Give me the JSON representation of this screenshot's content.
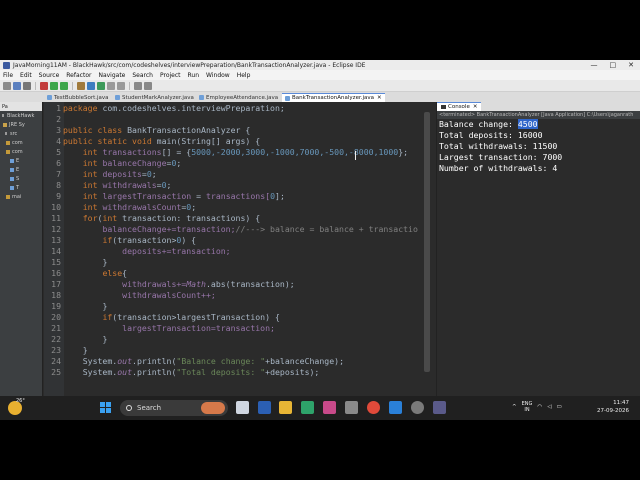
{
  "window": {
    "title": "JavaMorning11AM - BlackHawk/src/com/codeshelves/interviewPreparation/BankTransactionAnalyzer.java - Eclipse IDE",
    "controls": [
      "—",
      "□",
      "✕"
    ]
  },
  "menu": [
    "File",
    "Edit",
    "Source",
    "Refactor",
    "Navigate",
    "Search",
    "Project",
    "Run",
    "Window",
    "Help"
  ],
  "editor_tabs": [
    {
      "label": "TestBubbleSort.java"
    },
    {
      "label": "StudentMarkAnalyzer.java"
    },
    {
      "label": "EmployeeAttendance.java"
    },
    {
      "label": "BankTransactionAnalyzer.java",
      "close": "✕"
    }
  ],
  "sidebar": {
    "header": "Pa",
    "items": [
      "BlackHawk",
      "JRE Sy",
      "src",
      "com",
      "com",
      "E",
      "E",
      "S",
      "T",
      "mai"
    ]
  },
  "code": {
    "line_numbers": [
      "1",
      "2",
      "3",
      "4",
      "5",
      "6",
      "7",
      "8",
      "9",
      "10",
      "11",
      "12",
      "13",
      "14",
      "15",
      "16",
      "17",
      "18",
      "19",
      "20",
      "21",
      "22",
      "23",
      "24",
      "25"
    ],
    "l1": {
      "kw": "package",
      "rest": " com.codeshelves.interviewPreparation;"
    },
    "l3": {
      "kw1": "public",
      "kw2": "class",
      "name": " BankTransactionAnalyzer {"
    },
    "l4": {
      "kw1": "public",
      "kw2": "static",
      "kw3": "void",
      "rest": " main(String[] args) {"
    },
    "l5": {
      "kw": "int",
      "var": " transactions",
      "op": "[] = {",
      "nums": "5000,-2000,3000,-1000,7000,-500,-8000,1000",
      "end": "};"
    },
    "l6": {
      "kw": "int",
      "var": " balanceChange",
      "op": "=",
      "num": "0",
      "end": ";"
    },
    "l7": {
      "kw": "int",
      "var": " deposits",
      "op": "=",
      "num": "0",
      "end": ";"
    },
    "l8": {
      "kw": "int",
      "var": " withdrawals",
      "op": "=",
      "num": "0",
      "end": ";"
    },
    "l9": {
      "kw": "int",
      "var": " largestTransaction",
      "op": " = ",
      "rest": "transactions[",
      "num": "0",
      "end": "];"
    },
    "l10": {
      "kw": "int",
      "var": " withdrawalsCount",
      "op": "=",
      "num": "0",
      "end": ";"
    },
    "l11": {
      "kw": "for",
      "rest": "(",
      "kw2": "int",
      "rest2": " transaction: transactions) {"
    },
    "l12": {
      "code": "balanceChange+=transaction;",
      "comment": "//---> balance = balance + transactio"
    },
    "l13": {
      "kw": "if",
      "rest": "(transaction>",
      "num": "0",
      "end": ") {"
    },
    "l14": {
      "code": "deposits+=transaction;"
    },
    "l15": {
      "code": "}"
    },
    "l16": {
      "kw": "else",
      "code": "{"
    },
    "l17": {
      "pre": "withdrawals+=",
      "field": "Math",
      "post": ".abs(transaction);"
    },
    "l18": {
      "code": "withdrawalsCount++;"
    },
    "l19": {
      "code": "}"
    },
    "l20": {
      "kw": "if",
      "code": "(transaction>largestTransaction) {"
    },
    "l21": {
      "code": "largestTransaction=transaction;"
    },
    "l22": {
      "code": "}"
    },
    "l23": {
      "code": "}"
    },
    "l24": {
      "pre": "System.",
      "field": "out",
      "mid": ".println(",
      "str": "\"Balance change: \"",
      "end": "+balanceChange);"
    },
    "l25": {
      "pre": "System.",
      "field": "out",
      "mid": ".println(",
      "str": "\"Total deposits: \"",
      "end": "+deposits);"
    }
  },
  "console": {
    "tab_label": "Console",
    "tab_close": "✕",
    "status": "<terminated> BankTransactionAnalyzer [Java Application] C:\\Users\\jaganrath",
    "lines": [
      {
        "prefix": "Balance change: ",
        "selected": "4500",
        "suffix": ""
      },
      "Total deposits: 16000",
      "Total withdrawals: 11500",
      "Largest transaction: 7000",
      "Number of withdrawals: 4"
    ]
  },
  "taskbar": {
    "weather_temp": "26°",
    "search_label": "Search",
    "lang_1": "ENG",
    "lang_2": "IN",
    "time": "11:47",
    "date": "27-09-2026"
  }
}
